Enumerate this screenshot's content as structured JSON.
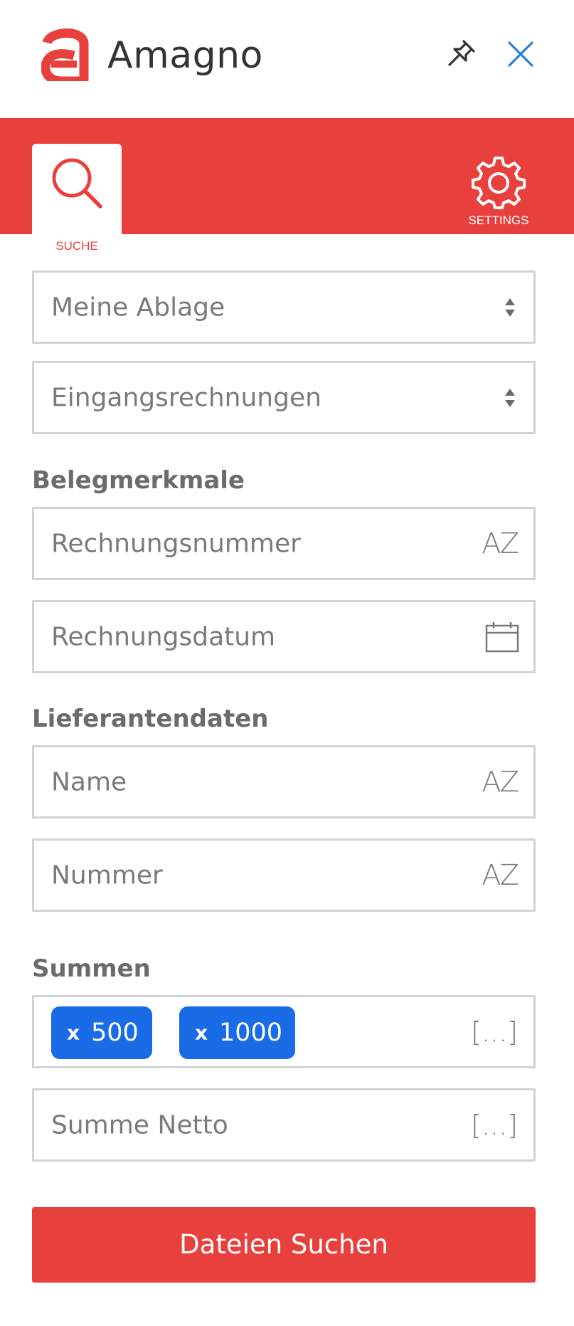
{
  "header": {
    "app_title": "Amagno",
    "logo_icon": "amagno-logo",
    "pin_icon": "pin-icon",
    "close_icon": "close-icon"
  },
  "tabs": {
    "search_label": "SUCHE",
    "settings_label": "SETTINGS",
    "active": "SUCHE"
  },
  "form": {
    "storage_select": "Meine Ablage",
    "type_select": "Eingangsrechnungen",
    "sections": {
      "document": "Belegmerkmale",
      "supplier": "Lieferantendaten",
      "sums": "Summen"
    },
    "invoice_number": {
      "placeholder": "Rechnungsnummer",
      "suffix": "AZ"
    },
    "invoice_date": {
      "placeholder": "Rechnungsdatum"
    },
    "supplier_name": {
      "placeholder": "Name",
      "suffix": "AZ"
    },
    "supplier_number": {
      "placeholder": "Nummer",
      "suffix": "AZ"
    },
    "sum_range": {
      "chips": [
        {
          "remove": "x",
          "value": "500"
        },
        {
          "remove": "x",
          "value": "1000"
        }
      ],
      "suffix": "[...]"
    },
    "net_sum": {
      "placeholder": "Summe Netto",
      "suffix": "[...]"
    }
  },
  "submit_label": "Dateien Suchen",
  "colors": {
    "brand_red": "#e8403d",
    "chip_blue": "#1a6be6",
    "close_blue": "#2a7fd4"
  }
}
